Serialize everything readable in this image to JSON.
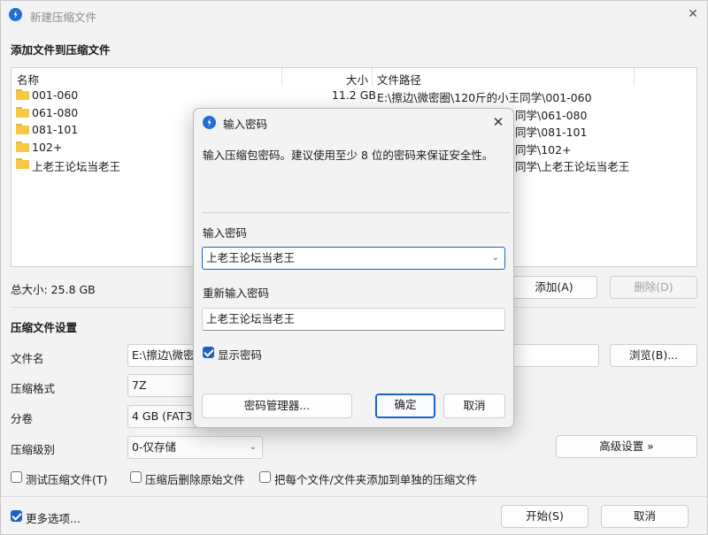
{
  "window": {
    "title": "新建压缩文件",
    "close_glyph": "✕"
  },
  "add_section": {
    "heading": "添加文件到压缩文件",
    "columns": {
      "name": "名称",
      "size": "大小",
      "path": "文件路径"
    },
    "rows": [
      {
        "name": "001-060",
        "size": "11.2 GB",
        "path": "E:\\擦边\\微密圈\\120斤的小王同学\\001-060"
      },
      {
        "name": "061-080",
        "size": "",
        "path": "同学\\061-080"
      },
      {
        "name": "081-101",
        "size": "",
        "path": "同学\\081-101"
      },
      {
        "name": "102+",
        "size": "",
        "path": "同学\\102+"
      },
      {
        "name": "上老王论坛当老王",
        "size": "",
        "path": "同学\\上老王论坛当老王"
      }
    ],
    "total": "总大小: 25.8 GB",
    "add_button": "添加(A)",
    "delete_button": "删除(D)"
  },
  "settings": {
    "heading": "压缩文件设置",
    "filename_label": "文件名",
    "filename_value": "E:\\擦边\\微密圈",
    "browse_button": "浏览(B)...",
    "format_label": "压缩格式",
    "format_value": "7Z",
    "split_label": "分卷",
    "split_value": "4 GB (FAT32",
    "level_label": "压缩级别",
    "level_value": "0-仅存储",
    "advanced_button": "高级设置 »",
    "test_checkbox": "测试压缩文件(T)",
    "delete_after_checkbox": "压缩后删除原始文件",
    "separate_checkbox": "把每个文件/文件夹添加到单独的压缩文件",
    "more_options": "更多选项...",
    "start_button": "开始(S)",
    "cancel_button": "取消"
  },
  "dialog": {
    "title": "输入密码",
    "close_glyph": "✕",
    "description": "输入压缩包密码。建议使用至少 8 位的密码来保证安全性。",
    "password_label": "输入密码",
    "password_value": "上老王论坛当老王",
    "repeat_label": "重新输入密码",
    "repeat_value": "上老王论坛当老王",
    "show_password": "显示密码",
    "manager_button": "密码管理器...",
    "ok_button": "确定",
    "cancel_button": "取消"
  },
  "colors": {
    "accent": "#1d61c4",
    "folder": "#f6c845"
  }
}
